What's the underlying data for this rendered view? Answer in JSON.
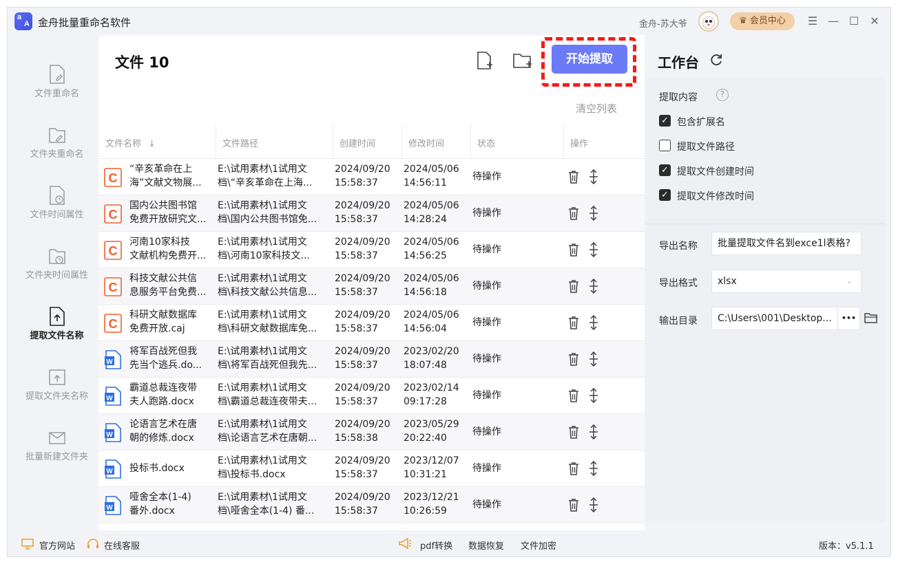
{
  "app": {
    "title": "金舟批量重命名软件",
    "user": "金舟-苏大爷",
    "vip_label": "会员中心"
  },
  "sidebar": {
    "items": [
      {
        "label": "文件重命名"
      },
      {
        "label": "文件夹重命名"
      },
      {
        "label": "文件时间属性"
      },
      {
        "label": "文件夹时间属性"
      },
      {
        "label": "提取文件名称"
      },
      {
        "label": "提取文件夹名称"
      },
      {
        "label": "批量新建文件夹"
      }
    ]
  },
  "main": {
    "title": "文件 10",
    "start_button": "开始提取",
    "clear_list": "清空列表",
    "columns": [
      "文件名称",
      "文件路径",
      "创建时间",
      "修改时间",
      "状态",
      "操作"
    ],
    "sort_arrow": "↓",
    "rows": [
      {
        "icon": "caj",
        "name1": "“辛亥革命在上",
        "name2": "海”文献文物展...",
        "path1": "E:\\试用素材\\1试用文",
        "path2": "档\\“辛亥革命在上海...",
        "created1": "2024/09/20",
        "created2": "15:58:37",
        "modified1": "2024/05/06",
        "modified2": "14:56:11",
        "status": "待操作"
      },
      {
        "icon": "caj",
        "name1": "国内公共图书馆",
        "name2": "免费开放研究文...",
        "path1": "E:\\试用素材\\1试用文",
        "path2": "档\\国内公共图书馆免...",
        "created1": "2024/09/20",
        "created2": "15:58:37",
        "modified1": "2024/05/06",
        "modified2": "14:28:24",
        "status": "待操作"
      },
      {
        "icon": "caj",
        "name1": "河南10家科技",
        "name2": "文献机构免费开...",
        "path1": "E:\\试用素材\\1试用文",
        "path2": "档\\河南10家科技文...",
        "created1": "2024/09/20",
        "created2": "15:58:37",
        "modified1": "2024/05/06",
        "modified2": "14:56:25",
        "status": "待操作"
      },
      {
        "icon": "caj",
        "name1": "科技文献公共信",
        "name2": "息服务平台免费...",
        "path1": "E:\\试用素材\\1试用文",
        "path2": "档\\科技文献公共信息...",
        "created1": "2024/09/20",
        "created2": "15:58:37",
        "modified1": "2024/05/06",
        "modified2": "14:56:18",
        "status": "待操作"
      },
      {
        "icon": "caj",
        "name1": "科研文献数据库",
        "name2": "免费开放.caj",
        "path1": "E:\\试用素材\\1试用文",
        "path2": "档\\科研文献数据库免...",
        "created1": "2024/09/20",
        "created2": "15:58:37",
        "modified1": "2024/05/06",
        "modified2": "14:56:04",
        "status": "待操作"
      },
      {
        "icon": "word",
        "name1": "将军百战死但我",
        "name2": "先当个逃兵.do...",
        "path1": "E:\\试用素材\\1试用文",
        "path2": "档\\将军百战死但我先...",
        "created1": "2024/09/20",
        "created2": "15:58:37",
        "modified1": "2023/02/20",
        "modified2": "18:07:48",
        "status": "待操作"
      },
      {
        "icon": "word",
        "name1": "霸道总裁连夜带",
        "name2": "夫人跑路.docx",
        "path1": "E:\\试用素材\\1试用文",
        "path2": "档\\霸道总裁连夜带夫...",
        "created1": "2024/09/20",
        "created2": "15:58:37",
        "modified1": "2023/02/14",
        "modified2": "09:17:28",
        "status": "待操作"
      },
      {
        "icon": "word",
        "name1": "论语言艺术在唐",
        "name2": "朝的修炼.docx",
        "path1": "E:\\试用素材\\1试用文",
        "path2": "档\\论语言艺术在唐朝...",
        "created1": "2024/09/20",
        "created2": "15:58:38",
        "modified1": "2023/05/29",
        "modified2": "20:22:40",
        "status": "待操作"
      },
      {
        "icon": "word",
        "name1": "投标书.docx",
        "name2": "",
        "path1": "E:\\试用素材\\1试用文",
        "path2": "档\\投标书.docx",
        "created1": "2024/09/20",
        "created2": "15:58:37",
        "modified1": "2023/12/07",
        "modified2": "10:31:21",
        "status": "待操作"
      },
      {
        "icon": "word",
        "name1": "哑舍全本(1-4)",
        "name2": "番外.docx",
        "path1": "E:\\试用素材\\1试用文",
        "path2": "档\\哑舍全本(1-4) 番...",
        "created1": "2024/09/20",
        "created2": "15:58:37",
        "modified1": "2023/12/21",
        "modified2": "10:26:59",
        "status": "待操作"
      }
    ]
  },
  "workbench": {
    "title": "工作台",
    "extract_label": "提取内容",
    "help": "?",
    "options": [
      {
        "label": "包含扩展名",
        "checked": true
      },
      {
        "label": "提取文件路径",
        "checked": false
      },
      {
        "label": "提取文件创建时间",
        "checked": true
      },
      {
        "label": "提取文件修改时间",
        "checked": true
      }
    ],
    "export_name_label": "导出名称",
    "export_name_value": "批量提取文件名到exce1l表格?",
    "export_format_label": "导出格式",
    "export_format_value": "xlsx",
    "output_dir_label": "输出目录",
    "output_dir_value": "C:\\Users\\001\\Desktop...",
    "more": "•••"
  },
  "footer": {
    "website": "官方网站",
    "service": "在线客服",
    "pdf": "pdf转换",
    "recovery": "数据恢复",
    "encrypt": "文件加密",
    "version": "版本：v5.1.1"
  },
  "colors": {
    "accent": "#6b7bf7",
    "highlight": "#f51a1a",
    "caj": "#f0602d",
    "word": "#2f6fe0"
  }
}
